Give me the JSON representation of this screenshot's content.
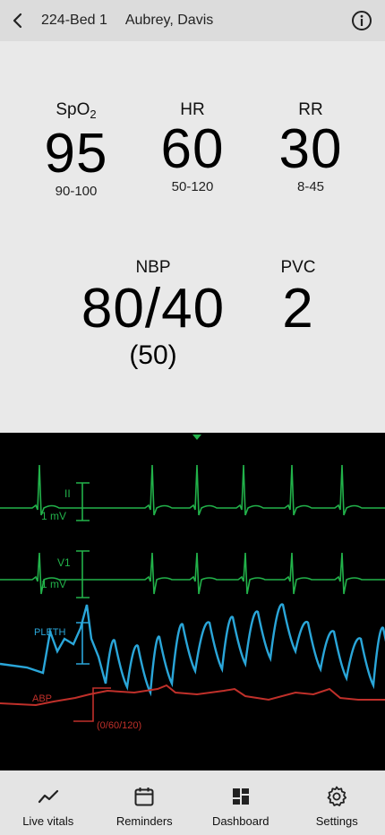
{
  "header": {
    "bed": "224-Bed 1",
    "patient": "Aubrey, Davis",
    "back_icon": "chevron-left-icon",
    "info_icon": "info-icon"
  },
  "vitals": {
    "spo2": {
      "label": "SpO",
      "label_sub": "2",
      "value": "95",
      "range": "90-100"
    },
    "hr": {
      "label": "HR",
      "value": "60",
      "range": "50-120"
    },
    "rr": {
      "label": "RR",
      "value": "30",
      "range": "8-45"
    },
    "nbp": {
      "label": "NBP",
      "value": "80/40",
      "mean": "(50)"
    },
    "pvc": {
      "label": "PVC",
      "value": "2"
    }
  },
  "waveforms": {
    "lead_ii": {
      "label": "II",
      "scale": "1 mV",
      "color": "#22b24a"
    },
    "lead_v1": {
      "label": "V1",
      "scale": "1 mV",
      "color": "#22b24a"
    },
    "pleth": {
      "label": "PLETH",
      "color": "#2aa6d9"
    },
    "abp": {
      "label": "ABP",
      "scale": "(0/60/120)",
      "color": "#c0302a"
    }
  },
  "nav": {
    "items": [
      {
        "label": "Live vitals",
        "icon": "trend-line-icon"
      },
      {
        "label": "Reminders",
        "icon": "calendar-icon"
      },
      {
        "label": "Dashboard",
        "icon": "dashboard-grid-icon"
      },
      {
        "label": "Settings",
        "icon": "gear-icon"
      }
    ]
  }
}
